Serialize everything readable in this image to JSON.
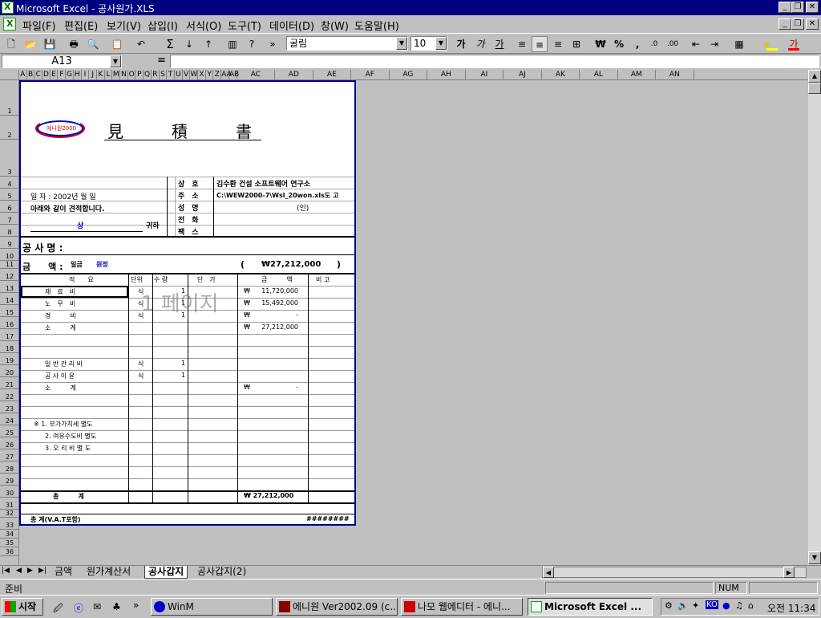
{
  "window": {
    "title": "Microsoft Excel - 공사원가.XLS"
  },
  "menu": [
    "파일(F)",
    "편집(E)",
    "보기(V)",
    "삽입(I)",
    "서식(O)",
    "도구(T)",
    "데이터(D)",
    "창(W)",
    "도움말(H)"
  ],
  "toolbar": {
    "font": "굴림",
    "size": "10",
    "bold": "가",
    "italic": "가",
    "underline": "가",
    "won": "₩",
    "percent": "%",
    "comma": ",",
    "sigma": "Σ"
  },
  "formula": {
    "namebox": "A13",
    "eq": "="
  },
  "columns": [
    "A",
    "B",
    "C",
    "D",
    "E",
    "F",
    "G",
    "H",
    "I",
    "J",
    "K",
    "L",
    "M",
    "N",
    "O",
    "P",
    "Q",
    "R",
    "S",
    "T",
    "U",
    "V",
    "W",
    "X",
    "Y",
    "Z",
    "AA",
    "AB",
    "AC",
    "AD",
    "AE",
    "AF",
    "AG",
    "AH",
    "AI",
    "AJ",
    "AK",
    "AL",
    "AM",
    "AN"
  ],
  "rows": [
    "1",
    "2",
    "3",
    "4",
    "5",
    "6",
    "7",
    "8",
    "9",
    "10",
    "11",
    "12",
    "13",
    "14",
    "15",
    "16",
    "17",
    "18",
    "19",
    "20",
    "21",
    "22",
    "23",
    "24",
    "25",
    "26",
    "27",
    "28",
    "29",
    "30",
    "31",
    "32",
    "33",
    "34",
    "35",
    "36"
  ],
  "doc": {
    "logo": "에니원2000",
    "title": "見　　　積　　　書",
    "date": "일 자 : 2002년   월   일",
    "request": "아래와 같이 견적합니다.",
    "sang": "상",
    "gwiha": "귀하",
    "label_sangho": "상　호",
    "sangho": "김수환 건설 소프트웨어 연구소",
    "label_juso": "주　소",
    "juso": "C:\\WEW2000-7\\Wsl_20won.xls도 고",
    "label_seongmyeong": "성　명",
    "in": "(인)",
    "label_jeonhwa": "전　화",
    "label_fax": "팩　스",
    "gongsamyeong": "공 사 명 :",
    "geumaek_label": "금　　액 :",
    "geumaek_han": "일금",
    "won_label": "원정",
    "open_paren": "(",
    "total": "₩27,212,000",
    "close_paren": ")",
    "header": [
      "적　　요",
      "단위",
      "수 량",
      "단　가",
      "금　　　액",
      "비 고"
    ],
    "page_watermark": "1 페이지",
    "lines": [
      {
        "name": "재　료　비",
        "unit": "식",
        "qty": "1",
        "won": "₩",
        "amount": "11,720,000"
      },
      {
        "name": "노　무　비",
        "unit": "식",
        "qty": "1",
        "won": "₩",
        "amount": "15,492,000"
      },
      {
        "name": "경　　　비",
        "unit": "식",
        "qty": "1",
        "won": "₩",
        "amount": "-"
      },
      {
        "name": "소　　　계",
        "unit": "",
        "qty": "",
        "won": "₩",
        "amount": "27,212,000"
      },
      {
        "name": "",
        "unit": "",
        "qty": "",
        "won": "",
        "amount": ""
      },
      {
        "name": "일 반 관 리 비",
        "unit": "식",
        "qty": "1",
        "won": "",
        "amount": ""
      },
      {
        "name": "공 사 이 윤",
        "unit": "식",
        "qty": "1",
        "won": "",
        "amount": ""
      },
      {
        "name": "소　　　계",
        "unit": "",
        "qty": "",
        "won": "₩",
        "amount": "-"
      }
    ],
    "notes": [
      "※ 1. 부가가치세 별도",
      "2. 여유수도비 별도",
      "3. 오 리 비 별 도"
    ],
    "sum_label": "총　　　계",
    "sum_value": "₩ 27,212,000",
    "vat_label": "총 계(V.A.T포함)",
    "vat_value": "########"
  },
  "sheets": [
    "금액",
    "원가계산서",
    "공사갑지",
    "공사갑지(2)"
  ],
  "status": {
    "ready": "준비",
    "num": "NUM"
  },
  "taskbar": {
    "start": "시작",
    "items": [
      "WinM",
      "에니원 Ver2002.09 (c...",
      "나모 웹에디터 - 에니...",
      "Microsoft Excel ..."
    ],
    "time": "오전 11:34",
    "ime": "KO"
  },
  "colors": {
    "title": "#000080",
    "border": "#00008b",
    "accent": "#0000cc"
  }
}
